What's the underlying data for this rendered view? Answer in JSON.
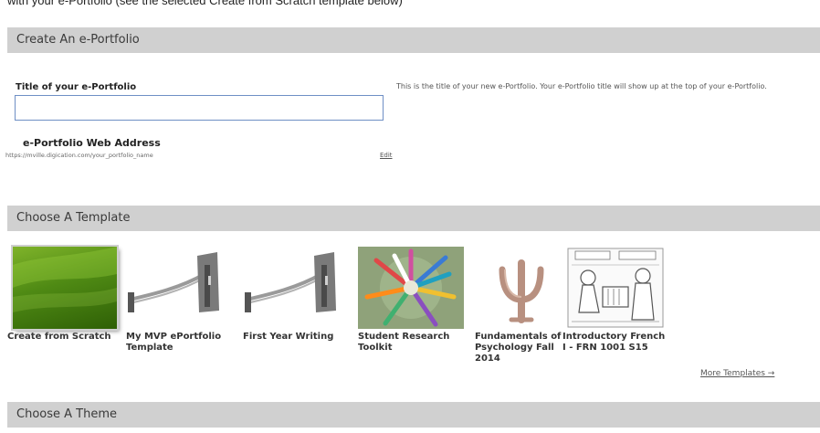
{
  "top_text": "with your e-Portfolio (see the selected Create from Scratch template below)",
  "sections": {
    "create": "Create An e-Portfolio",
    "template": "Choose A Template",
    "theme": "Choose A Theme"
  },
  "form": {
    "title_label": "Title of your e-Portfolio",
    "title_value": "",
    "title_help": "This is the title of your new e-Portfolio. Your e-Portfolio title will show up at the top of your e-Portfolio.",
    "address_label": "e-Portfolio Web Address",
    "address_url": "https://mville.digication.com/your_portfolio_name",
    "edit_label": "Edit"
  },
  "templates": [
    {
      "name": "Create from Scratch",
      "icon": "green-gradient-thumbnail",
      "selected": true
    },
    {
      "name": "My MVP ePortfolio Template",
      "icon": "bridge-thumbnail"
    },
    {
      "name": "First Year Writing",
      "icon": "bridge-thumbnail"
    },
    {
      "name": "Student Research Toolkit",
      "icon": "colored-pencils-thumbnail"
    },
    {
      "name": "Fundamentals of Psychology Fall 2014",
      "icon": "psi-symbol-thumbnail"
    },
    {
      "name": "Introductory French I - FRN 1001 S15",
      "icon": "comic-sketch-thumbnail"
    }
  ],
  "more_templates": "More Templates →",
  "colors": {
    "section_bar": "#d0d0d0",
    "input_border": "#6f8fc5",
    "scratch_green": "#4f8a14"
  }
}
